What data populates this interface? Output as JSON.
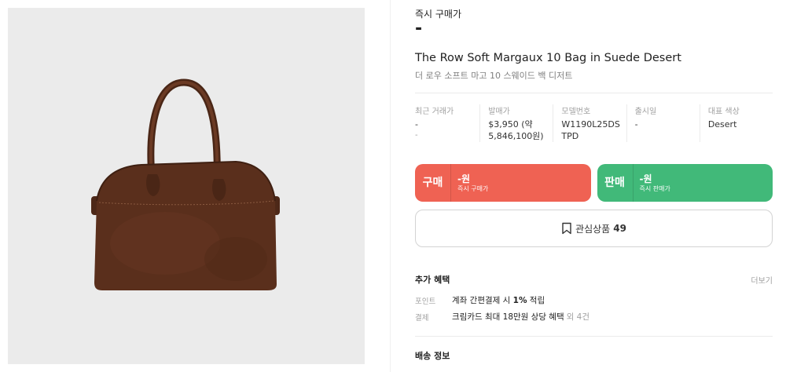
{
  "product_image": {
    "alt": "The Row Soft Margaux 10 Bag in Suede Desert",
    "bg_color": "#ebebeb",
    "bag_color": "#5a2f1c"
  },
  "buy_now": {
    "label": "즉시 구매가",
    "price": "-"
  },
  "title": {
    "en": "The Row Soft Margaux 10 Bag in Suede Desert",
    "ko": "더 로우 소프트 마고 10 스웨이드 백 디저트"
  },
  "stats": [
    {
      "label": "최근 거래가",
      "value": "-",
      "sub": "-"
    },
    {
      "label": "발매가",
      "value": "$3,950 (약\n5,846,100원)",
      "sub": ""
    },
    {
      "label": "모델번호",
      "value": "W1190L25DS\nTPD",
      "sub": ""
    },
    {
      "label": "출시일",
      "value": "-",
      "sub": ""
    },
    {
      "label": "대표 색상",
      "value": "Desert",
      "sub": ""
    }
  ],
  "buy_button": {
    "label": "구매",
    "price": "-원",
    "sub": "즉시 구매가",
    "color": "#ef6253"
  },
  "sell_button": {
    "label": "판매",
    "price": "-원",
    "sub": "즉시 판매가",
    "color": "#41b979"
  },
  "wishlist": {
    "label": "관심상품",
    "count": "49",
    "icon": "bookmark-icon"
  },
  "benefits": {
    "title": "추가 혜택",
    "more": "더보기",
    "point": {
      "key": "포인트",
      "text_before": "계좌 간편결제 시 ",
      "highlight": "1%",
      "text_after": " 적립"
    },
    "payment": {
      "key": "결제",
      "text": "크림카드 최대 18만원 상당 혜택",
      "extra": "외 4건"
    }
  },
  "delivery": {
    "title": "배송 정보"
  }
}
